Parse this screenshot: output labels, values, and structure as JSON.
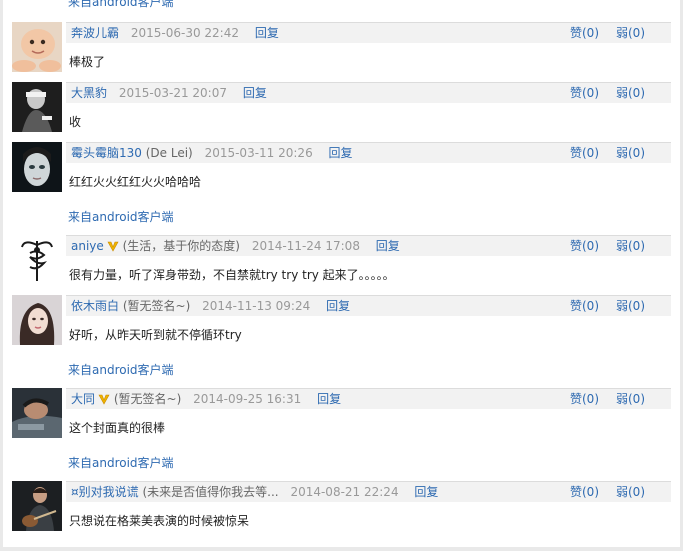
{
  "top_source": "来自android客户端",
  "comments": [
    {
      "user": "奔波儿霸",
      "signature": "",
      "time": "2015-06-30 22:42",
      "reply": "回复",
      "like": "赞(0)",
      "dislike": "弱(0)",
      "content": "棒极了",
      "client": "",
      "vip": false,
      "avatar_icon": "baby-photo"
    },
    {
      "user": "大黑豹",
      "signature": "",
      "time": "2015-03-21 20:07",
      "reply": "回复",
      "like": "赞(0)",
      "dislike": "弱(0)",
      "content": "收",
      "client": "",
      "vip": false,
      "avatar_icon": "person-hood-photo"
    },
    {
      "user": "霉头霉脑130",
      "signature": "(De Lei)",
      "time": "2015-03-11 20:26",
      "reply": "回复",
      "like": "赞(0)",
      "dislike": "弱(0)",
      "content": "红红火火红红火火哈哈哈",
      "client": "来自android客户端",
      "vip": false,
      "avatar_icon": "face-closeup-photo"
    },
    {
      "user": "aniye",
      "signature": "(生活，基于你的态度)",
      "time": "2014-11-24 17:08",
      "reply": "回复",
      "like": "赞(0)",
      "dislike": "弱(0)",
      "content": "很有力量，听了浑身带劲，不自禁就try try try 起来了。。。。。",
      "client": "",
      "vip": true,
      "avatar_icon": "caduceus-icon"
    },
    {
      "user": "依木雨白",
      "signature": "(暂无签名~)",
      "time": "2014-11-13 09:24",
      "reply": "回复",
      "like": "赞(0)",
      "dislike": "弱(0)",
      "content": "好听，从昨天听到就不停循环try",
      "client": "来自android客户端",
      "vip": false,
      "avatar_icon": "woman-portrait-photo"
    },
    {
      "user": "大同",
      "signature": "(暂无签名~)",
      "time": "2014-09-25 16:31",
      "reply": "回复",
      "like": "赞(0)",
      "dislike": "弱(0)",
      "content": "这个封面真的很棒",
      "client": "来自android客户端",
      "vip": true,
      "avatar_icon": "man-lying-photo"
    },
    {
      "user": "¤别对我说谎",
      "signature": "(未来是否值得你我去等...",
      "time": "2014-08-21 22:24",
      "reply": "回复",
      "like": "赞(0)",
      "dislike": "弱(0)",
      "content": "只想说在格莱美表演的时候被惊呆",
      "client": "",
      "vip": false,
      "avatar_icon": "guitarist-photo"
    }
  ]
}
